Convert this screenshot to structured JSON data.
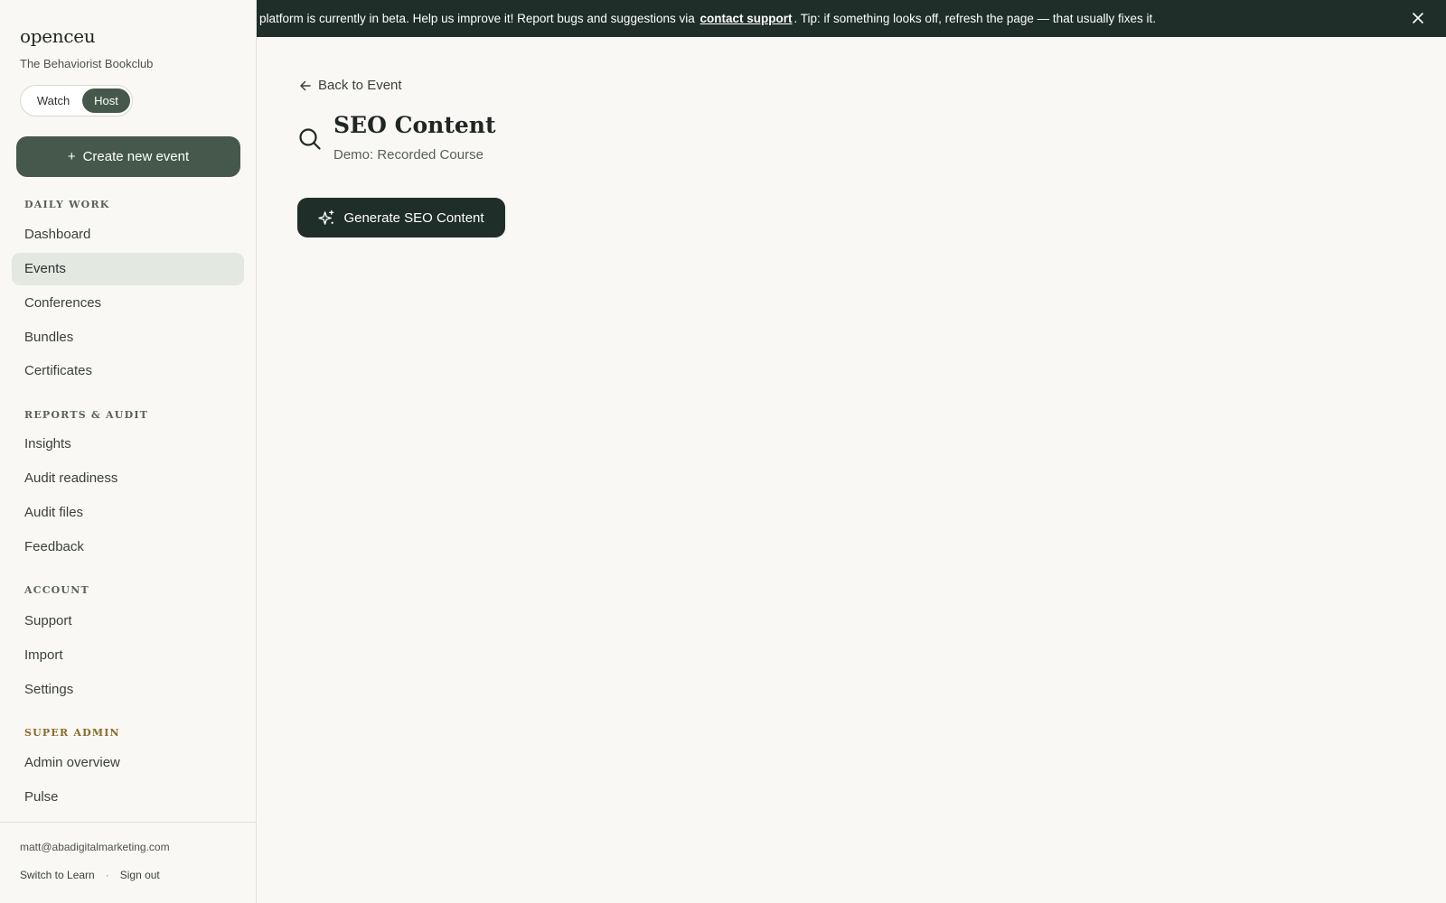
{
  "sidebar": {
    "brand": "openceu",
    "org": "The Behaviorist Bookclub",
    "mode_toggle": {
      "watch": "Watch",
      "host": "Host",
      "selected": "Host"
    },
    "create_button": "Create new event",
    "create_button_icon": "+",
    "sections": {
      "daily_work": "DAILY WORK",
      "reports": "REPORTS & AUDIT",
      "account": "ACCOUNT",
      "super_admin": "SUPER ADMIN"
    },
    "items": {
      "dashboard": "Dashboard",
      "events": "Events",
      "conferences": "Conferences",
      "bundles": "Bundles",
      "certificates": "Certificates",
      "insights": "Insights",
      "audit_readiness": "Audit readiness",
      "audit_files": "Audit files",
      "feedback": "Feedback",
      "support": "Support",
      "import": "Import",
      "settings": "Settings",
      "admin_overview": "Admin overview",
      "pulse": "Pulse"
    },
    "active_item": "Events",
    "footer": {
      "email": "matt@abadigitalmarketing.com",
      "switch": "Switch to Learn",
      "separator": "·",
      "signout": "Sign out"
    }
  },
  "banner": {
    "text_before": "platform is currently in beta. Help us improve it! Report bugs and suggestions via",
    "link": "contact support",
    "text_after": ". Tip: if something looks off, refresh the page — that usually fixes it."
  },
  "main": {
    "back_label": "Back to Event",
    "title": "SEO Content",
    "subtitle": "Demo: Recorded Course",
    "generate_button": "Generate SEO Content"
  },
  "colors": {
    "accent": "#46584b",
    "dark": "#1f2e29",
    "background": "#f9f8f4",
    "active_nav": "#e3e8e0",
    "admin_label": "#8a6a2c"
  }
}
